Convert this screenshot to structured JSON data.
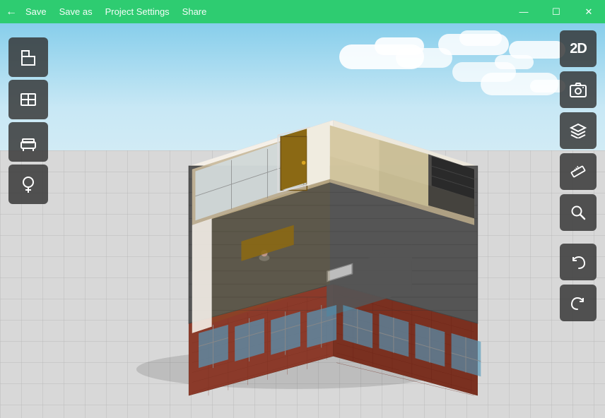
{
  "titlebar": {
    "back_label": "←",
    "save_label": "Save",
    "saveas_label": "Save as",
    "projectsettings_label": "Project Settings",
    "share_label": "Share",
    "minimize_label": "—",
    "maximize_label": "☐",
    "close_label": "✕"
  },
  "right_panel": {
    "view2d_label": "2D",
    "camera_icon": "📷",
    "layers_icon": "layers",
    "ruler_icon": "ruler",
    "search_icon": "search",
    "undo_icon": "undo",
    "redo_icon": "redo"
  },
  "left_panel": {
    "room_icon": "room",
    "window_icon": "window",
    "furniture_icon": "furniture",
    "plant_icon": "plant"
  },
  "colors": {
    "titlebar_green": "#27c46a",
    "panel_dark": "#333333"
  }
}
